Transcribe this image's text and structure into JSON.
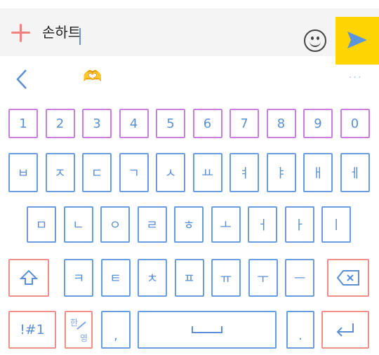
{
  "input": {
    "text": "손하트"
  },
  "toolbar": {
    "heart": "🫶",
    "more": "···"
  },
  "keyboard": {
    "numbers": [
      "1",
      "2",
      "3",
      "4",
      "5",
      "6",
      "7",
      "8",
      "9",
      "0"
    ],
    "row1": [
      "ㅂ",
      "ㅈ",
      "ㄷ",
      "ㄱ",
      "ㅅ",
      "ㅛ",
      "ㅕ",
      "ㅑ",
      "ㅐ",
      "ㅔ"
    ],
    "row2": [
      "ㅁ",
      "ㄴ",
      "ㅇ",
      "ㄹ",
      "ㅎ",
      "ㅗ",
      "ㅓ",
      "ㅏ",
      "ㅣ"
    ],
    "row3": [
      "ㅋ",
      "ㅌ",
      "ㅊ",
      "ㅍ",
      "ㅠ",
      "ㅜ",
      "ㅡ"
    ],
    "symbols_label": "!#1",
    "lang_top": "한",
    "lang_bottom": "영",
    "comma": ",",
    "period": "."
  },
  "colors": {
    "accent_send": "#ffd400",
    "key_blue": "#6a9de0",
    "key_purple": "#c77fde",
    "key_red": "#ef8f8a",
    "plus": "#f0837b"
  }
}
